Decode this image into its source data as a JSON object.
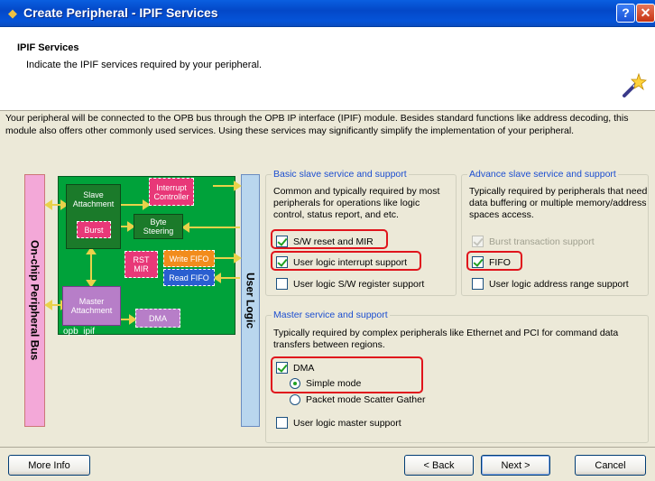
{
  "window": {
    "title": "Create Peripheral - IPIF Services",
    "help_label": "?",
    "close_label": "✕"
  },
  "header": {
    "title": "IPIF Services",
    "subtitle": "Indicate the IPIF services required by your peripheral."
  },
  "intro": "Your peripheral will be connected to the OPB bus through the OPB IP interface (IPIF) module. Besides standard functions like address decoding, this module also offers other commonly used services. Using these services may significantly simplify the implementation of your peripheral.",
  "diagram": {
    "left_bus": "On-chip Peripheral Bus",
    "right_bus": "User Logic",
    "core": "opb_ipif",
    "blocks": {
      "slave_attachment": "Slave Attachment",
      "interrupt_controller": "Interrupt Controller",
      "burst": "Burst",
      "byte_steering": "Byte Steering",
      "rst_mir": "RST MIR",
      "write_fifo": "Write FIFO",
      "read_fifo": "Read FIFO",
      "master_attachment": "Master Attachment",
      "dma": "DMA"
    }
  },
  "basic_slave": {
    "legend": "Basic slave service and support",
    "description": "Common and typically required by most peripherals for operations like logic control, status report, and etc.",
    "options": [
      {
        "label": "S/W reset and MIR",
        "checked": true
      },
      {
        "label": "User logic interrupt support",
        "checked": true
      },
      {
        "label": "User logic S/W register support",
        "checked": false
      }
    ]
  },
  "advance_slave": {
    "legend": "Advance slave service and support",
    "description": "Typically required by peripherals that need data buffering or multiple memory/address spaces access.",
    "options": [
      {
        "label": "Burst transaction support",
        "checked": true,
        "disabled": true
      },
      {
        "label": "FIFO",
        "checked": true
      },
      {
        "label": "User logic address range support",
        "checked": false
      }
    ]
  },
  "master": {
    "legend": "Master service and support",
    "description": "Typically required by complex peripherals like Ethernet and PCI for command data transfers between regions.",
    "dma_label": "DMA",
    "dma_checked": true,
    "modes": [
      {
        "label": "Simple mode",
        "selected": true
      },
      {
        "label": "Packet mode Scatter Gather",
        "selected": false
      }
    ],
    "master_support_label": "User logic master support",
    "master_support_checked": false
  },
  "buttons": {
    "more_info": "More Info",
    "back": "< Back",
    "next": "Next >",
    "cancel": "Cancel"
  },
  "colors": {
    "highlight": "#e0141c",
    "legend": "#1c4ed0",
    "ipif_green": "#00a23a",
    "bus_pink": "#f3a8d8",
    "bus_blue": "#b9d6ee"
  }
}
